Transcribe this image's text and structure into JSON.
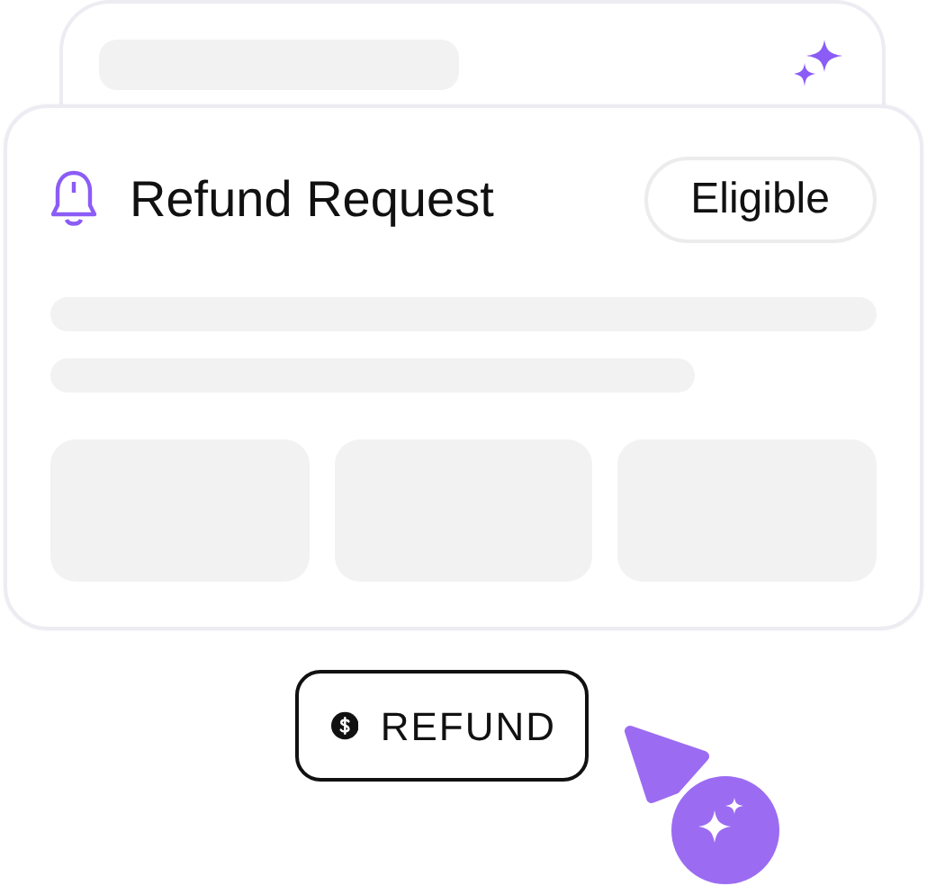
{
  "card": {
    "title": "Refund Request",
    "status_badge": "Eligible"
  },
  "action_button": {
    "label": "REFUND"
  }
}
